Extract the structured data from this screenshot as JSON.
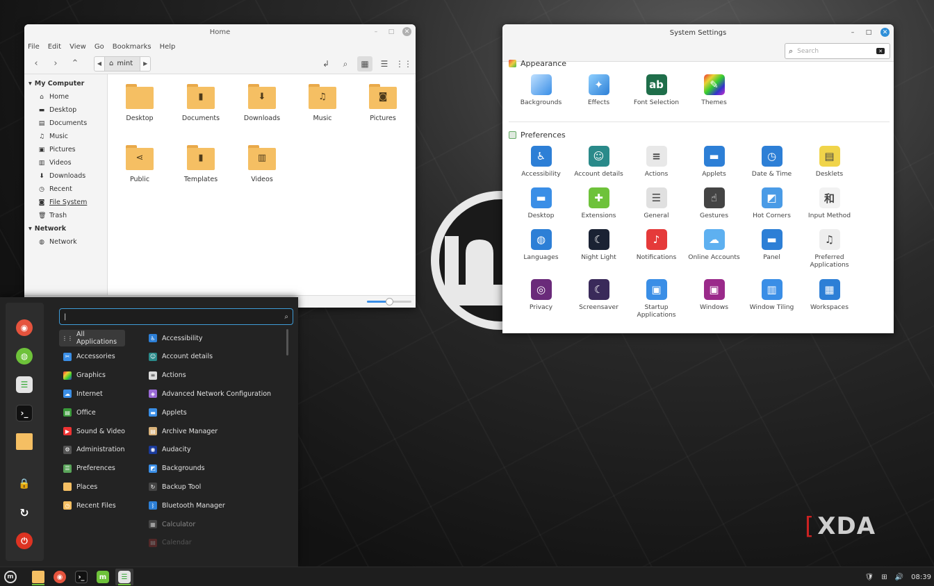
{
  "file_manager": {
    "title": "Home",
    "menu": [
      "File",
      "Edit",
      "View",
      "Go",
      "Bookmarks",
      "Help"
    ],
    "path_segment": "mint",
    "sidebar": {
      "my_computer": "My Computer",
      "items": [
        "Home",
        "Desktop",
        "Documents",
        "Music",
        "Pictures",
        "Videos",
        "Downloads",
        "Recent",
        "File System",
        "Trash"
      ],
      "network_head": "Network",
      "network_items": [
        "Network"
      ]
    },
    "folders": [
      "Desktop",
      "Documents",
      "Downloads",
      "Music",
      "Pictures",
      "Public",
      "Templates",
      "Videos"
    ],
    "zoom_level": 0.5
  },
  "settings": {
    "title": "System Settings",
    "search_placeholder": "Search",
    "appearance": {
      "heading": "Appearance",
      "items": [
        "Backgrounds",
        "Effects",
        "Font Selection",
        "Themes"
      ]
    },
    "preferences": {
      "heading": "Preferences",
      "items": [
        "Accessibility",
        "Account details",
        "Actions",
        "Applets",
        "Date & Time",
        "Desklets",
        "Desktop",
        "Extensions",
        "General",
        "Gestures",
        "Hot Corners",
        "Input Method",
        "Languages",
        "Night Light",
        "Notifications",
        "Online Accounts",
        "Panel",
        "Preferred Applications",
        "Privacy",
        "Screensaver",
        "Startup Applications",
        "Windows",
        "Window Tiling",
        "Workspaces"
      ]
    }
  },
  "menu": {
    "search_value": "|",
    "categories": [
      "All Applications",
      "Accessories",
      "Graphics",
      "Internet",
      "Office",
      "Sound & Video",
      "Administration",
      "Preferences",
      "Places",
      "Recent Files"
    ],
    "apps": [
      "Accessibility",
      "Account details",
      "Actions",
      "Advanced Network Configuration",
      "Applets",
      "Archive Manager",
      "Audacity",
      "Backgrounds",
      "Backup Tool",
      "Bluetooth Manager",
      "Calculator",
      "Calendar"
    ]
  },
  "taskbar": {
    "clock": "08:39"
  },
  "watermark": "XDA",
  "colors": {
    "folder": "#f5bf63",
    "accent_blue": "#3f9cd8",
    "mint_green": "#6ec23a"
  }
}
